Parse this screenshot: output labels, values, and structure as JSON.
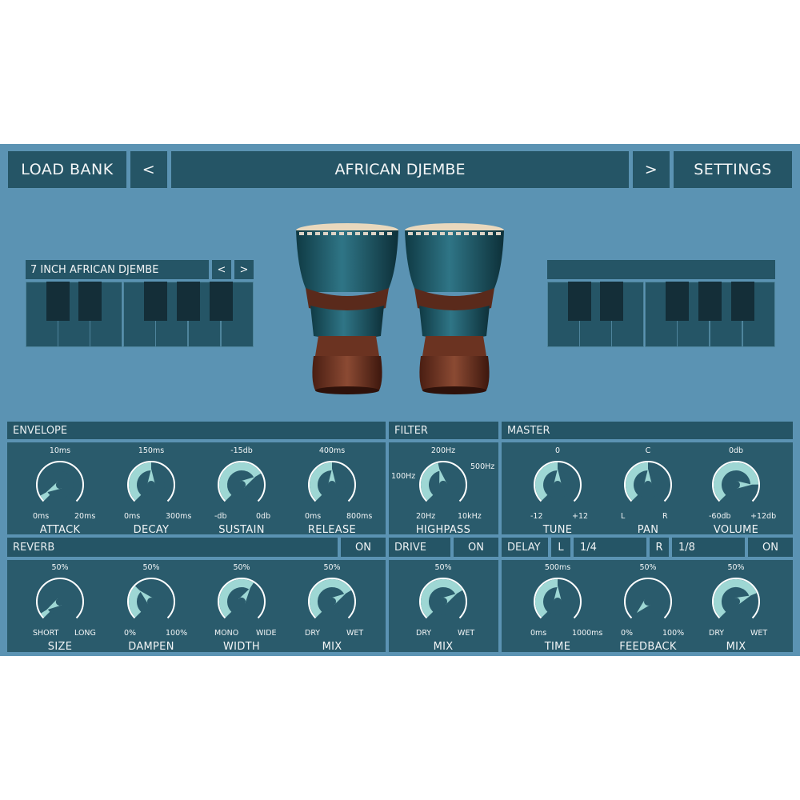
{
  "header": {
    "load_bank": "LOAD BANK",
    "prev": "<",
    "bank_name": "AFRICAN DJEMBE",
    "next": ">",
    "settings": "SETTINGS"
  },
  "instrument": {
    "name": "7 INCH AFRICAN DJEMBE",
    "prev": "<",
    "next": ">"
  },
  "sections": {
    "envelope": "ENVELOPE",
    "filter": "FILTER",
    "master": "MASTER",
    "reverb": "REVERB",
    "reverb_toggle": "ON",
    "drive": "DRIVE",
    "drive_toggle": "ON",
    "delay": "DELAY",
    "delay_l": "L",
    "delay_l_value": "1/4",
    "delay_r": "R",
    "delay_r_value": "1/8",
    "delay_toggle": "ON"
  },
  "knobs": {
    "attack": {
      "label": "ATTACK",
      "value": "10ms",
      "min": "0ms",
      "max": "20ms",
      "level": 0.06
    },
    "decay": {
      "label": "DECAY",
      "value": "150ms",
      "min": "0ms",
      "max": "300ms",
      "level": 0.5
    },
    "sustain": {
      "label": "SUSTAIN",
      "value": "-15db",
      "min": "-db",
      "max": "0db",
      "level": 0.72
    },
    "release": {
      "label": "RELEASE",
      "value": "400ms",
      "min": "0ms",
      "max": "800ms",
      "level": 0.5
    },
    "highpass": {
      "label": "HIGHPASS",
      "value": "200Hz",
      "min": "20Hz",
      "max": "10kHz",
      "left": "100Hz",
      "right": "500Hz",
      "level": 0.45
    },
    "tune": {
      "label": "TUNE",
      "value": "0",
      "min": "-12",
      "max": "+12",
      "level": 0.5
    },
    "pan": {
      "label": "PAN",
      "value": "C",
      "min": "L",
      "max": "R",
      "level": 0.5
    },
    "volume": {
      "label": "VOLUME",
      "value": "0db",
      "min": "-60db",
      "max": "+12db",
      "level": 0.83
    },
    "size": {
      "label": "SIZE",
      "value": "50%",
      "min": "SHORT",
      "max": "LONG",
      "level": 0.05
    },
    "dampen": {
      "label": "DAMPEN",
      "value": "50%",
      "min": "0%",
      "max": "100%",
      "level": 0.33
    },
    "width": {
      "label": "WIDTH",
      "value": "50%",
      "min": "MONO",
      "max": "WIDE",
      "level": 0.62
    },
    "mix_rev": {
      "label": "MIX",
      "value": "50%",
      "min": "DRY",
      "max": "WET",
      "level": 0.72
    },
    "mix_drive": {
      "label": "MIX",
      "value": "50%",
      "min": "DRY",
      "max": "WET",
      "level": 0.72
    },
    "time": {
      "label": "TIME",
      "value": "500ms",
      "min": "0ms",
      "max": "1000ms",
      "level": 0.5
    },
    "feedback": {
      "label": "FEEDBACK",
      "value": "50%",
      "min": "0%",
      "max": "100%",
      "level": 0.0
    },
    "mix_delay": {
      "label": "MIX",
      "value": "50%",
      "min": "DRY",
      "max": "WET",
      "level": 0.75
    }
  },
  "colors": {
    "background": "#5b93b3",
    "panel": "#255566",
    "knob_fill": "#9ed7d4",
    "knob_ring": "#ffffff",
    "knob_body": "#2a5b6c"
  }
}
